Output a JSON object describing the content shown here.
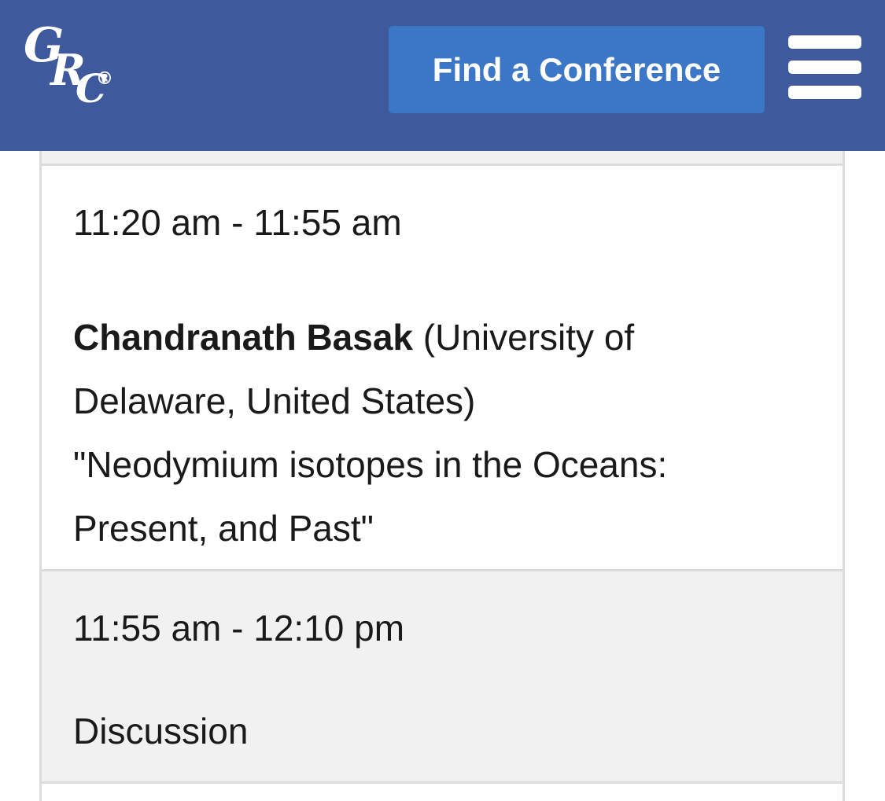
{
  "header": {
    "logo": {
      "letters": [
        "G",
        "R",
        "C"
      ],
      "registered_mark": "®"
    },
    "find_button_label": "Find a Conference",
    "menu_icon": "hamburger-menu-icon",
    "background_color": "#3f5a9c",
    "button_color": "#3c76c7"
  },
  "agenda": {
    "items": [
      {
        "time": "11:20 am - 11:55 am",
        "speaker": "Chandranath Basak",
        "details": " (University of Delaware, United States)",
        "title": "\"Neodymium isotopes in the Oceans: Present, and Past\""
      },
      {
        "time": "11:55 am - 12:10 pm",
        "label": "Discussion"
      }
    ]
  }
}
